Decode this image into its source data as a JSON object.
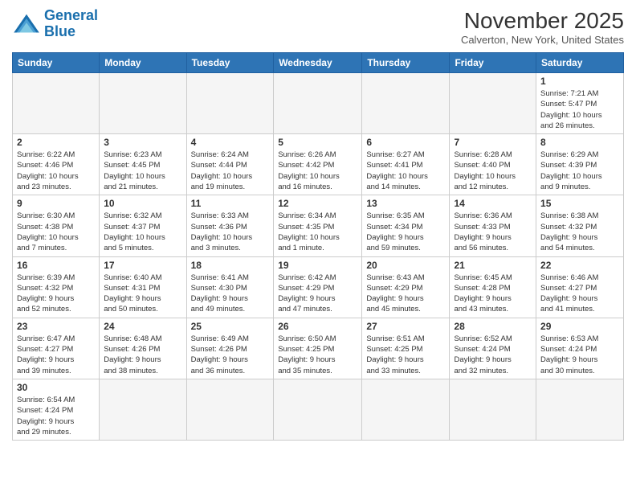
{
  "logo": {
    "line1": "General",
    "line2": "Blue"
  },
  "title": "November 2025",
  "subtitle": "Calverton, New York, United States",
  "days_of_week": [
    "Sunday",
    "Monday",
    "Tuesday",
    "Wednesday",
    "Thursday",
    "Friday",
    "Saturday"
  ],
  "weeks": [
    [
      {
        "day": "",
        "info": ""
      },
      {
        "day": "",
        "info": ""
      },
      {
        "day": "",
        "info": ""
      },
      {
        "day": "",
        "info": ""
      },
      {
        "day": "",
        "info": ""
      },
      {
        "day": "",
        "info": ""
      },
      {
        "day": "1",
        "info": "Sunrise: 7:21 AM\nSunset: 5:47 PM\nDaylight: 10 hours\nand 26 minutes."
      }
    ],
    [
      {
        "day": "2",
        "info": "Sunrise: 6:22 AM\nSunset: 4:46 PM\nDaylight: 10 hours\nand 23 minutes."
      },
      {
        "day": "3",
        "info": "Sunrise: 6:23 AM\nSunset: 4:45 PM\nDaylight: 10 hours\nand 21 minutes."
      },
      {
        "day": "4",
        "info": "Sunrise: 6:24 AM\nSunset: 4:44 PM\nDaylight: 10 hours\nand 19 minutes."
      },
      {
        "day": "5",
        "info": "Sunrise: 6:26 AM\nSunset: 4:42 PM\nDaylight: 10 hours\nand 16 minutes."
      },
      {
        "day": "6",
        "info": "Sunrise: 6:27 AM\nSunset: 4:41 PM\nDaylight: 10 hours\nand 14 minutes."
      },
      {
        "day": "7",
        "info": "Sunrise: 6:28 AM\nSunset: 4:40 PM\nDaylight: 10 hours\nand 12 minutes."
      },
      {
        "day": "8",
        "info": "Sunrise: 6:29 AM\nSunset: 4:39 PM\nDaylight: 10 hours\nand 9 minutes."
      }
    ],
    [
      {
        "day": "9",
        "info": "Sunrise: 6:30 AM\nSunset: 4:38 PM\nDaylight: 10 hours\nand 7 minutes."
      },
      {
        "day": "10",
        "info": "Sunrise: 6:32 AM\nSunset: 4:37 PM\nDaylight: 10 hours\nand 5 minutes."
      },
      {
        "day": "11",
        "info": "Sunrise: 6:33 AM\nSunset: 4:36 PM\nDaylight: 10 hours\nand 3 minutes."
      },
      {
        "day": "12",
        "info": "Sunrise: 6:34 AM\nSunset: 4:35 PM\nDaylight: 10 hours\nand 1 minute."
      },
      {
        "day": "13",
        "info": "Sunrise: 6:35 AM\nSunset: 4:34 PM\nDaylight: 9 hours\nand 59 minutes."
      },
      {
        "day": "14",
        "info": "Sunrise: 6:36 AM\nSunset: 4:33 PM\nDaylight: 9 hours\nand 56 minutes."
      },
      {
        "day": "15",
        "info": "Sunrise: 6:38 AM\nSunset: 4:32 PM\nDaylight: 9 hours\nand 54 minutes."
      }
    ],
    [
      {
        "day": "16",
        "info": "Sunrise: 6:39 AM\nSunset: 4:32 PM\nDaylight: 9 hours\nand 52 minutes."
      },
      {
        "day": "17",
        "info": "Sunrise: 6:40 AM\nSunset: 4:31 PM\nDaylight: 9 hours\nand 50 minutes."
      },
      {
        "day": "18",
        "info": "Sunrise: 6:41 AM\nSunset: 4:30 PM\nDaylight: 9 hours\nand 49 minutes."
      },
      {
        "day": "19",
        "info": "Sunrise: 6:42 AM\nSunset: 4:29 PM\nDaylight: 9 hours\nand 47 minutes."
      },
      {
        "day": "20",
        "info": "Sunrise: 6:43 AM\nSunset: 4:29 PM\nDaylight: 9 hours\nand 45 minutes."
      },
      {
        "day": "21",
        "info": "Sunrise: 6:45 AM\nSunset: 4:28 PM\nDaylight: 9 hours\nand 43 minutes."
      },
      {
        "day": "22",
        "info": "Sunrise: 6:46 AM\nSunset: 4:27 PM\nDaylight: 9 hours\nand 41 minutes."
      }
    ],
    [
      {
        "day": "23",
        "info": "Sunrise: 6:47 AM\nSunset: 4:27 PM\nDaylight: 9 hours\nand 39 minutes."
      },
      {
        "day": "24",
        "info": "Sunrise: 6:48 AM\nSunset: 4:26 PM\nDaylight: 9 hours\nand 38 minutes."
      },
      {
        "day": "25",
        "info": "Sunrise: 6:49 AM\nSunset: 4:26 PM\nDaylight: 9 hours\nand 36 minutes."
      },
      {
        "day": "26",
        "info": "Sunrise: 6:50 AM\nSunset: 4:25 PM\nDaylight: 9 hours\nand 35 minutes."
      },
      {
        "day": "27",
        "info": "Sunrise: 6:51 AM\nSunset: 4:25 PM\nDaylight: 9 hours\nand 33 minutes."
      },
      {
        "day": "28",
        "info": "Sunrise: 6:52 AM\nSunset: 4:24 PM\nDaylight: 9 hours\nand 32 minutes."
      },
      {
        "day": "29",
        "info": "Sunrise: 6:53 AM\nSunset: 4:24 PM\nDaylight: 9 hours\nand 30 minutes."
      }
    ],
    [
      {
        "day": "30",
        "info": "Sunrise: 6:54 AM\nSunset: 4:24 PM\nDaylight: 9 hours\nand 29 minutes."
      },
      {
        "day": "",
        "info": ""
      },
      {
        "day": "",
        "info": ""
      },
      {
        "day": "",
        "info": ""
      },
      {
        "day": "",
        "info": ""
      },
      {
        "day": "",
        "info": ""
      },
      {
        "day": "",
        "info": ""
      }
    ]
  ]
}
